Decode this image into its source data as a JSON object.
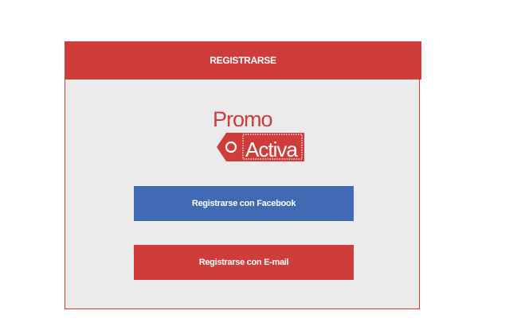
{
  "modal": {
    "title": "REGISTRARSE"
  },
  "logo": {
    "word_top": "Promo",
    "word_bottom": "Activa"
  },
  "buttons": {
    "facebook_label": "Registrarse con Facebook",
    "email_label": "Registrarse con E-mail"
  },
  "colors": {
    "brand_red": "#cf3c3a",
    "facebook_blue": "#4169b4",
    "panel_gray": "#ebebeb"
  }
}
